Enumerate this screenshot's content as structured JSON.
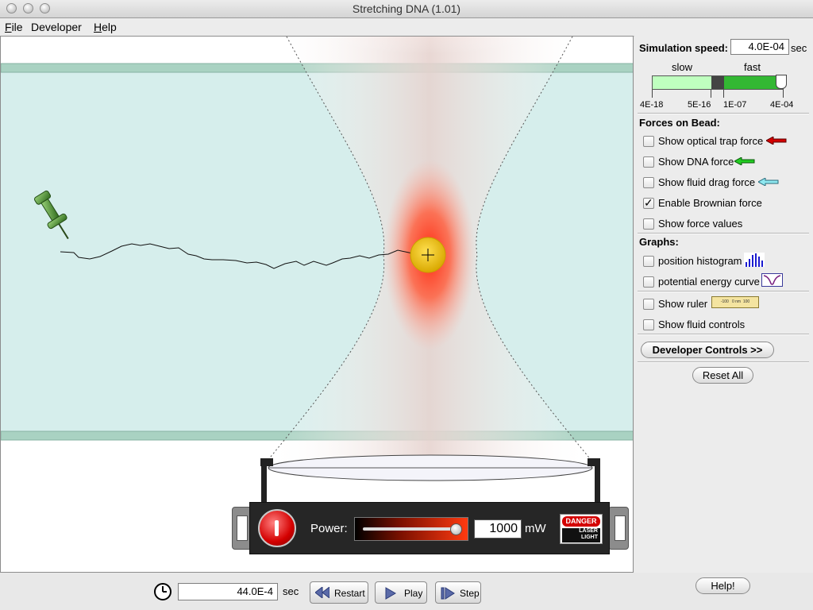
{
  "window": {
    "title": "Stretching DNA (1.01)"
  },
  "menu": {
    "file": "File",
    "developer": "Developer",
    "help": "Help"
  },
  "speed": {
    "label": "Simulation speed:",
    "value": "4.0E-04",
    "unit": "sec",
    "slow": "slow",
    "fast": "fast",
    "ticks": [
      "4E-18",
      "5E-16",
      "1E-07",
      "4E-04"
    ]
  },
  "forces": {
    "heading": "Forces on Bead:",
    "optical": "Show optical trap force",
    "dna": "Show DNA force",
    "drag": "Show fluid drag force",
    "brownian": "Enable Brownian force",
    "values": "Show force values",
    "brownian_checked": true
  },
  "graphs": {
    "heading": "Graphs:",
    "histogram": "position histogram",
    "energy": "potential energy curve",
    "ruler": "Show ruler",
    "ruler_icon_text": "-100   0 nm  100",
    "fluid": "Show fluid controls"
  },
  "buttons": {
    "developer_controls": "Developer Controls >>",
    "reset_all": "Reset All",
    "help": "Help!",
    "restart": "Restart",
    "play": "Play",
    "step": "Step"
  },
  "clock": {
    "value": "44.0E-4",
    "unit": "sec"
  },
  "laser": {
    "power_label": "Power:",
    "power_value": "1000",
    "power_unit": "mW",
    "power_fraction": 1.0,
    "danger": "DANGER",
    "laser_light": "LASER\nLIGHT"
  },
  "colors": {
    "fluid": "#d6eeec",
    "wall": "#a9d2c2",
    "bead": "#e8c020",
    "trap_red": "#ff2a10",
    "slider_green": "#33b833",
    "slider_light": "#bfffbf"
  }
}
